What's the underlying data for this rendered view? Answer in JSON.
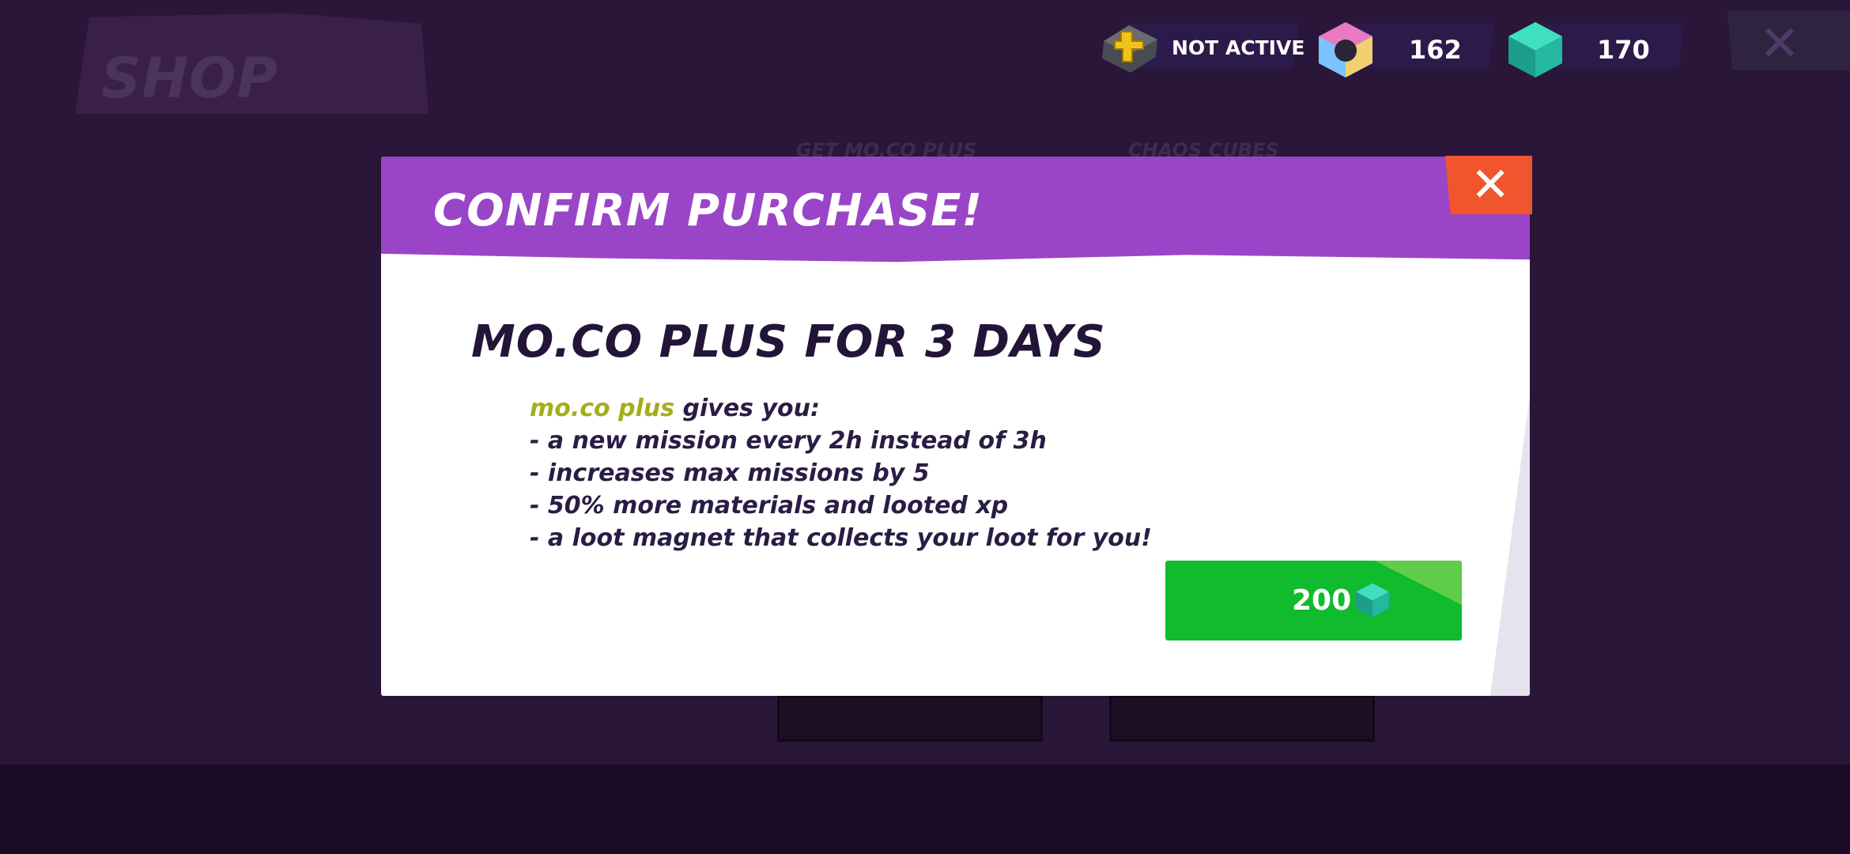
{
  "shop": {
    "title": "SHOP"
  },
  "currency": {
    "plus_status": "NOT ACTIVE",
    "chaos_cubes": "162",
    "gems": "170"
  },
  "background_tabs": [
    "GET MO.CO PLUS",
    "CHAOS CUBES"
  ],
  "modal": {
    "title": "CONFIRM PURCHASE!",
    "offer_title": "MO.CO PLUS FOR 3 DAYS",
    "highlight": "mo.co plus",
    "intro": " gives you:",
    "benefits": [
      "- a new mission every 2h instead of 3h",
      "- increases max missions by 5",
      "- 50% more materials and looted xp",
      "- a loot magnet that collects your loot for you!"
    ],
    "price": "200"
  },
  "icons": {
    "plus": "plus-key-icon",
    "chaos": "chaos-cube-icon",
    "gem": "gem-cube-icon",
    "close": "close-icon"
  },
  "colors": {
    "header": "#9a45c8",
    "buy_button": "#10bb2e",
    "close_button": "#f0552e",
    "highlight": "#a6ad1a"
  }
}
